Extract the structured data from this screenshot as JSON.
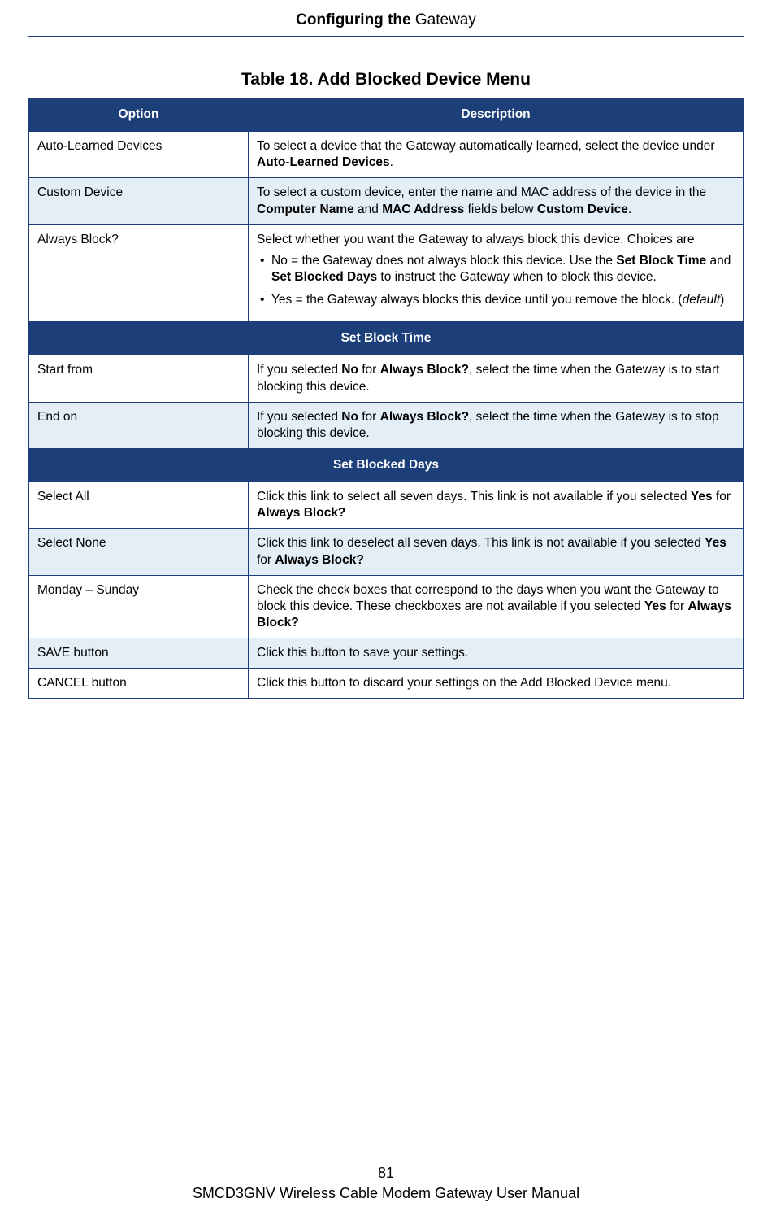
{
  "header": {
    "strong": "Configuring the ",
    "light": "Gateway"
  },
  "caption": "Table 18. Add Blocked Device Menu",
  "col": {
    "option": "Option",
    "desc": "Description"
  },
  "r1": {
    "opt": "Auto-Learned Devices",
    "t1": "To select a device that the Gateway automatically learned, select the device under ",
    "b1": "Auto-Learned Devices",
    "t2": "."
  },
  "r2": {
    "opt": "Custom Device",
    "t1": "To select a custom device, enter the name and MAC address of the device in the ",
    "b1": "Computer Name",
    "t2": " and ",
    "b2": "MAC Address",
    "t3": " fields below ",
    "b3": "Custom Device",
    "t4": "."
  },
  "r3": {
    "opt": "Always Block?",
    "lead": "Select whether you want the Gateway to always block this device. Choices are",
    "li1a": "No = the Gateway does not always block this device. Use the ",
    "li1b1": "Set Block Time",
    "li1c": " and ",
    "li1b2": "Set Blocked Days",
    "li1d": " to instruct the Gateway when to block this device.",
    "li2a": "Yes = the Gateway always blocks this device until you remove the block. (",
    "li2i": "default",
    "li2b": ")"
  },
  "sub1": "Set Block Time",
  "r4": {
    "opt": "Start from",
    "t1": "If you selected ",
    "b1": "No",
    "t2": " for ",
    "b2": "Always Block?",
    "t3": ", select the time when the Gateway is to start blocking this device."
  },
  "r5": {
    "opt": "End on",
    "t1": "If you selected ",
    "b1": "No",
    "t2": " for ",
    "b2": "Always Block?",
    "t3": ", select the time when the Gateway is to stop blocking this device."
  },
  "sub2": "Set Blocked Days",
  "r6": {
    "opt": "Select All",
    "t1": "Click this link to select all seven days. This link is not available if you selected ",
    "b1": "Yes",
    "t2": " for ",
    "b2": "Always Block?"
  },
  "r7": {
    "opt": "Select None",
    "t1": "Click this link to deselect all seven days. This link is not available if you selected ",
    "b1": "Yes",
    "t2": " for ",
    "b2": "Always Block?"
  },
  "r8": {
    "opt": "Monday – Sunday",
    "t1": "Check the check boxes that correspond to the days when you want the Gateway to block this device. These checkboxes are not available if you selected ",
    "b1": "Yes",
    "t2": " for ",
    "b2": "Always Block?"
  },
  "r9": {
    "opt": "SAVE button",
    "d": "Click this button to save your settings."
  },
  "r10": {
    "opt": "CANCEL button",
    "d": "Click this button to discard your settings on the Add Blocked Device menu."
  },
  "footer": {
    "page": "81",
    "manual": "SMCD3GNV Wireless Cable Modem Gateway User Manual"
  }
}
